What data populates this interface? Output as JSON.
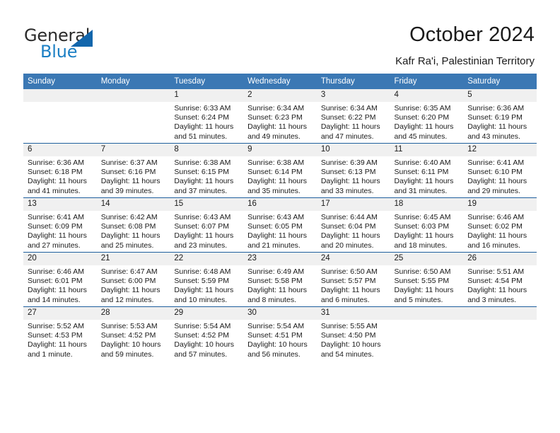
{
  "brand": {
    "name_top": "General",
    "name_bottom": "Blue",
    "logo_icon": "triangle-icon",
    "color_dark": "#2b2b2b",
    "color_blue": "#1b7fc4",
    "color_triangle": "#1266ac"
  },
  "header": {
    "title": "October 2024",
    "subtitle": "Kafr Ra'i, Palestinian Territory"
  },
  "theme": {
    "header_row_bg": "#3b78b4",
    "header_row_text": "#ffffff",
    "daynum_bg": "#f0f0f0",
    "row_divider": "#1f5f9e"
  },
  "calendar": {
    "weekday_headers": [
      "Sunday",
      "Monday",
      "Tuesday",
      "Wednesday",
      "Thursday",
      "Friday",
      "Saturday"
    ],
    "weeks": [
      [
        {
          "day": "",
          "sunrise": "",
          "sunset": "",
          "daylight": "",
          "empty": true
        },
        {
          "day": "",
          "sunrise": "",
          "sunset": "",
          "daylight": "",
          "empty": true
        },
        {
          "day": "1",
          "sunrise": "Sunrise: 6:33 AM",
          "sunset": "Sunset: 6:24 PM",
          "daylight": "Daylight: 11 hours and 51 minutes."
        },
        {
          "day": "2",
          "sunrise": "Sunrise: 6:34 AM",
          "sunset": "Sunset: 6:23 PM",
          "daylight": "Daylight: 11 hours and 49 minutes."
        },
        {
          "day": "3",
          "sunrise": "Sunrise: 6:34 AM",
          "sunset": "Sunset: 6:22 PM",
          "daylight": "Daylight: 11 hours and 47 minutes."
        },
        {
          "day": "4",
          "sunrise": "Sunrise: 6:35 AM",
          "sunset": "Sunset: 6:20 PM",
          "daylight": "Daylight: 11 hours and 45 minutes."
        },
        {
          "day": "5",
          "sunrise": "Sunrise: 6:36 AM",
          "sunset": "Sunset: 6:19 PM",
          "daylight": "Daylight: 11 hours and 43 minutes."
        }
      ],
      [
        {
          "day": "6",
          "sunrise": "Sunrise: 6:36 AM",
          "sunset": "Sunset: 6:18 PM",
          "daylight": "Daylight: 11 hours and 41 minutes."
        },
        {
          "day": "7",
          "sunrise": "Sunrise: 6:37 AM",
          "sunset": "Sunset: 6:16 PM",
          "daylight": "Daylight: 11 hours and 39 minutes."
        },
        {
          "day": "8",
          "sunrise": "Sunrise: 6:38 AM",
          "sunset": "Sunset: 6:15 PM",
          "daylight": "Daylight: 11 hours and 37 minutes."
        },
        {
          "day": "9",
          "sunrise": "Sunrise: 6:38 AM",
          "sunset": "Sunset: 6:14 PM",
          "daylight": "Daylight: 11 hours and 35 minutes."
        },
        {
          "day": "10",
          "sunrise": "Sunrise: 6:39 AM",
          "sunset": "Sunset: 6:13 PM",
          "daylight": "Daylight: 11 hours and 33 minutes."
        },
        {
          "day": "11",
          "sunrise": "Sunrise: 6:40 AM",
          "sunset": "Sunset: 6:11 PM",
          "daylight": "Daylight: 11 hours and 31 minutes."
        },
        {
          "day": "12",
          "sunrise": "Sunrise: 6:41 AM",
          "sunset": "Sunset: 6:10 PM",
          "daylight": "Daylight: 11 hours and 29 minutes."
        }
      ],
      [
        {
          "day": "13",
          "sunrise": "Sunrise: 6:41 AM",
          "sunset": "Sunset: 6:09 PM",
          "daylight": "Daylight: 11 hours and 27 minutes."
        },
        {
          "day": "14",
          "sunrise": "Sunrise: 6:42 AM",
          "sunset": "Sunset: 6:08 PM",
          "daylight": "Daylight: 11 hours and 25 minutes."
        },
        {
          "day": "15",
          "sunrise": "Sunrise: 6:43 AM",
          "sunset": "Sunset: 6:07 PM",
          "daylight": "Daylight: 11 hours and 23 minutes."
        },
        {
          "day": "16",
          "sunrise": "Sunrise: 6:43 AM",
          "sunset": "Sunset: 6:05 PM",
          "daylight": "Daylight: 11 hours and 21 minutes."
        },
        {
          "day": "17",
          "sunrise": "Sunrise: 6:44 AM",
          "sunset": "Sunset: 6:04 PM",
          "daylight": "Daylight: 11 hours and 20 minutes."
        },
        {
          "day": "18",
          "sunrise": "Sunrise: 6:45 AM",
          "sunset": "Sunset: 6:03 PM",
          "daylight": "Daylight: 11 hours and 18 minutes."
        },
        {
          "day": "19",
          "sunrise": "Sunrise: 6:46 AM",
          "sunset": "Sunset: 6:02 PM",
          "daylight": "Daylight: 11 hours and 16 minutes."
        }
      ],
      [
        {
          "day": "20",
          "sunrise": "Sunrise: 6:46 AM",
          "sunset": "Sunset: 6:01 PM",
          "daylight": "Daylight: 11 hours and 14 minutes."
        },
        {
          "day": "21",
          "sunrise": "Sunrise: 6:47 AM",
          "sunset": "Sunset: 6:00 PM",
          "daylight": "Daylight: 11 hours and 12 minutes."
        },
        {
          "day": "22",
          "sunrise": "Sunrise: 6:48 AM",
          "sunset": "Sunset: 5:59 PM",
          "daylight": "Daylight: 11 hours and 10 minutes."
        },
        {
          "day": "23",
          "sunrise": "Sunrise: 6:49 AM",
          "sunset": "Sunset: 5:58 PM",
          "daylight": "Daylight: 11 hours and 8 minutes."
        },
        {
          "day": "24",
          "sunrise": "Sunrise: 6:50 AM",
          "sunset": "Sunset: 5:57 PM",
          "daylight": "Daylight: 11 hours and 6 minutes."
        },
        {
          "day": "25",
          "sunrise": "Sunrise: 6:50 AM",
          "sunset": "Sunset: 5:55 PM",
          "daylight": "Daylight: 11 hours and 5 minutes."
        },
        {
          "day": "26",
          "sunrise": "Sunrise: 5:51 AM",
          "sunset": "Sunset: 4:54 PM",
          "daylight": "Daylight: 11 hours and 3 minutes."
        }
      ],
      [
        {
          "day": "27",
          "sunrise": "Sunrise: 5:52 AM",
          "sunset": "Sunset: 4:53 PM",
          "daylight": "Daylight: 11 hours and 1 minute."
        },
        {
          "day": "28",
          "sunrise": "Sunrise: 5:53 AM",
          "sunset": "Sunset: 4:52 PM",
          "daylight": "Daylight: 10 hours and 59 minutes."
        },
        {
          "day": "29",
          "sunrise": "Sunrise: 5:54 AM",
          "sunset": "Sunset: 4:52 PM",
          "daylight": "Daylight: 10 hours and 57 minutes."
        },
        {
          "day": "30",
          "sunrise": "Sunrise: 5:54 AM",
          "sunset": "Sunset: 4:51 PM",
          "daylight": "Daylight: 10 hours and 56 minutes."
        },
        {
          "day": "31",
          "sunrise": "Sunrise: 5:55 AM",
          "sunset": "Sunset: 4:50 PM",
          "daylight": "Daylight: 10 hours and 54 minutes."
        },
        {
          "day": "",
          "sunrise": "",
          "sunset": "",
          "daylight": "",
          "empty": true
        },
        {
          "day": "",
          "sunrise": "",
          "sunset": "",
          "daylight": "",
          "empty": true
        }
      ]
    ]
  }
}
